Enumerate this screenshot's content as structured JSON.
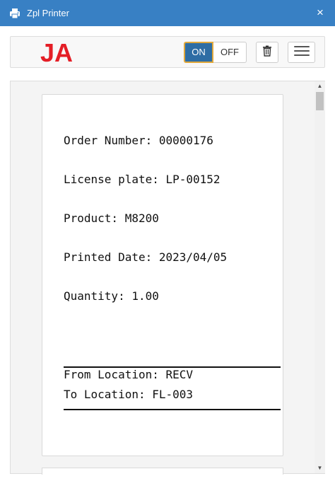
{
  "window": {
    "title": "Zpl Printer",
    "icon": "printer-icon",
    "close_glyph": "×"
  },
  "toolbar": {
    "logo_text": "JA",
    "logo_color": "#e41e26",
    "on_label": "ON",
    "off_label": "OFF",
    "active_toggle": "ON",
    "trash_icon": "trash-icon",
    "menu_icon": "hamburger-menu-icon"
  },
  "label": {
    "order_number": "Order Number: 00000176",
    "license_plate": "License plate: LP-00152",
    "product": "Product: M8200",
    "printed_date": "Printed Date: 2023/04/05",
    "quantity": "Quantity: 1.00",
    "from_location": "From Location: RECV",
    "to_location": "To Location: FL-003"
  },
  "colors": {
    "titlebar": "#3880c4",
    "toggle_active": "#2e6da4",
    "toggle_focus_ring": "#e0a83c"
  }
}
